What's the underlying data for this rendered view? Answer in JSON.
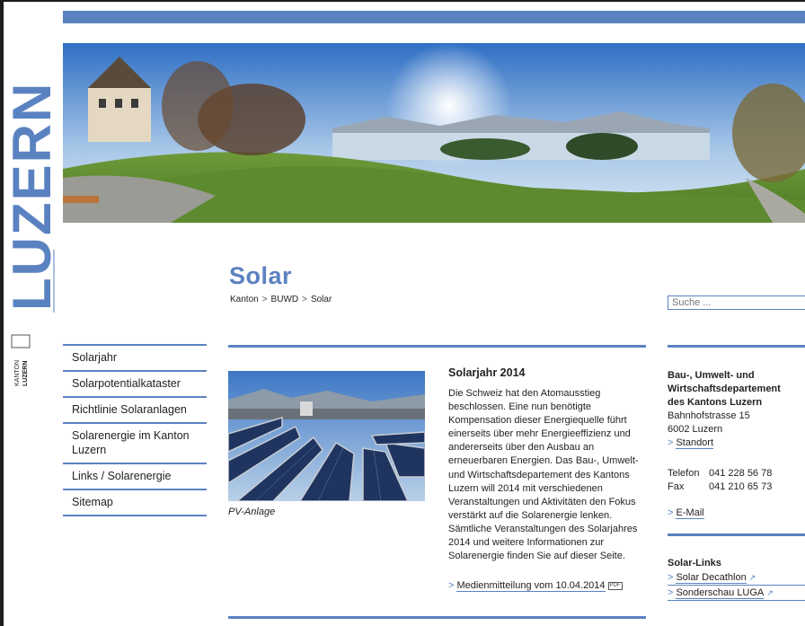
{
  "logo": {
    "wordmark": "LUZERN",
    "sub_top": "KANTON",
    "sub_bottom": "LUZERN"
  },
  "page": {
    "title": "Solar"
  },
  "breadcrumb": [
    "Kanton",
    "BUWD",
    "Solar"
  ],
  "search": {
    "placeholder": "Suche ..."
  },
  "nav": [
    "Solarjahr",
    "Solarpotentialkataster",
    "Richtlinie Solaranlagen",
    "Solarenergie im Kanton Luzern",
    "Links / Solarenergie",
    "Sitemap"
  ],
  "photo": {
    "caption": "PV-Anlage"
  },
  "article": {
    "heading": "Solarjahr 2014",
    "body": "Die Schweiz hat den Atomausstieg beschlossen. Eine nun benötigte Kompensation dieser Energiequelle führt einerseits über mehr Energieeffizienz und andererseits über den Ausbau an erneuerbaren Energien. Das Bau-, Umwelt- und Wirtschaftsdepartement des Kantons Luzern will 2014 mit verschiedenen Veranstaltungen und Aktivitäten den Fokus verstärkt auf die Solarenergie lenken. Sämtliche Veranstaltungen des Solarjahres 2014 und weitere Informationen zur Solarenergie finden Sie auf dieser Seite.",
    "link_label": "Medienmitteilung vom 10.04.2014",
    "link_badge": "PDF"
  },
  "contact": {
    "dept_line1": "Bau-, Umwelt- und",
    "dept_line2": "Wirtschaftsdepartement",
    "dept_line3": "des Kantons Luzern",
    "street": "Bahnhofstrasse 15",
    "city": "6002 Luzern",
    "location_link": "Standort",
    "phone_label": "Telefon",
    "phone": "041 228 56 78",
    "fax_label": "Fax",
    "fax": "041 210 65 73",
    "email_link": "E-Mail"
  },
  "solar_links": {
    "heading": "Solar-Links",
    "items": [
      "Solar Decathlon",
      "Sonderschau LUGA"
    ]
  },
  "colors": {
    "accent": "#5b82c0",
    "text": "#222222"
  }
}
